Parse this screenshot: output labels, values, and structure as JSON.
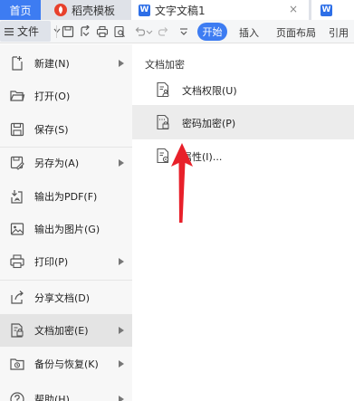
{
  "tabs": {
    "home": "首页",
    "docer": "稻壳模板",
    "document": "文字文稿1",
    "close": "×",
    "doc2_letter": "W"
  },
  "toolbar": {
    "file_label": "文件",
    "start": "开始",
    "insert": "插入",
    "page_layout": "页面布局",
    "reference": "引用"
  },
  "file_menu": {
    "items": [
      {
        "label": "新建(N)",
        "icon": "new-icon",
        "submenu": true
      },
      {
        "label": "打开(O)",
        "icon": "folder-open-icon",
        "submenu": false
      },
      {
        "label": "保存(S)",
        "icon": "save-icon",
        "submenu": false
      },
      {
        "label": "另存为(A)",
        "icon": "save-as-icon",
        "submenu": true
      },
      {
        "label": "输出为PDF(F)",
        "icon": "pdf-icon",
        "submenu": false
      },
      {
        "label": "输出为图片(G)",
        "icon": "image-icon",
        "submenu": false
      },
      {
        "label": "打印(P)",
        "icon": "print-icon",
        "submenu": true
      },
      {
        "label": "分享文档(D)",
        "icon": "share-icon",
        "submenu": false
      },
      {
        "label": "文档加密(E)",
        "icon": "encrypt-icon",
        "submenu": true,
        "active": true
      },
      {
        "label": "备份与恢复(K)",
        "icon": "backup-icon",
        "submenu": true
      },
      {
        "label": "帮助(H)",
        "icon": "help-icon",
        "submenu": true
      }
    ]
  },
  "encrypt_submenu": {
    "title": "文档加密",
    "items": [
      {
        "label": "文档权限(U)",
        "icon": "doc-permission-icon"
      },
      {
        "label": "密码加密(P)",
        "icon": "password-lock-icon",
        "active": true
      },
      {
        "label": "属性(I)...",
        "icon": "properties-icon"
      }
    ]
  },
  "colors": {
    "accent": "#3d7cf2",
    "annotation": "#e8202a",
    "menu_bg": "#f7f7f7",
    "active_bg": "#e4e4e4"
  }
}
